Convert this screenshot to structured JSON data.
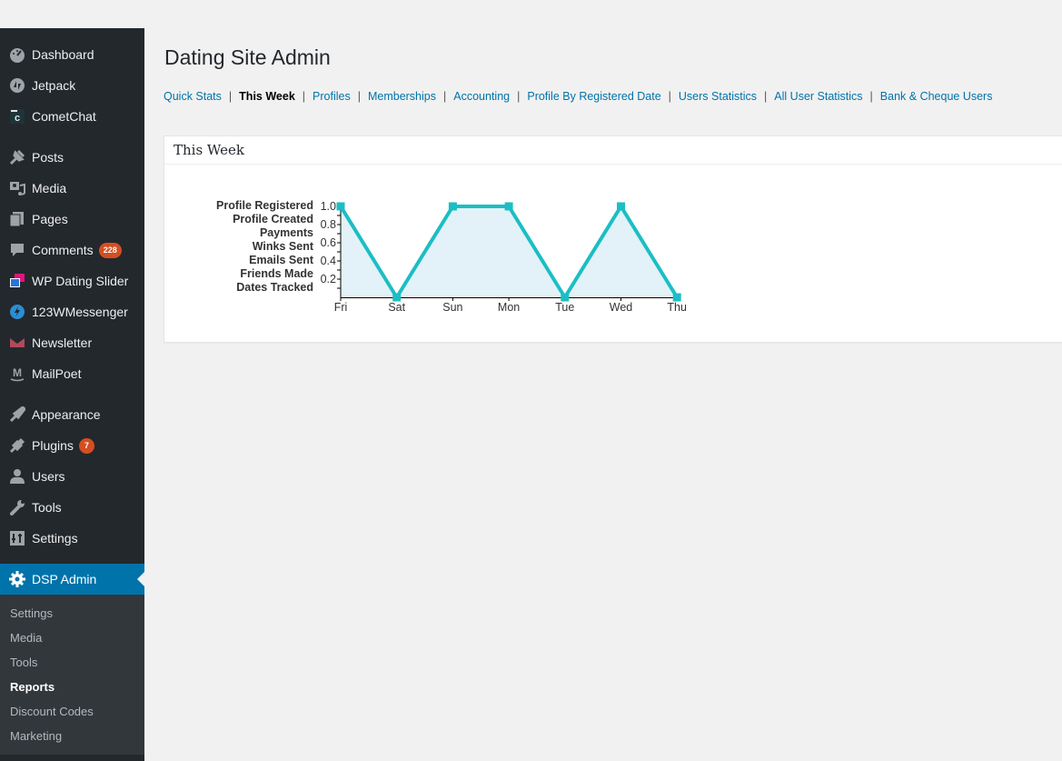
{
  "sidebar": {
    "items": [
      {
        "label": "Dashboard",
        "icon": "dashboard-icon"
      },
      {
        "label": "Jetpack",
        "icon": "jetpack-icon"
      },
      {
        "label": "CometChat",
        "icon": "cometchat-icon"
      },
      {
        "label": "Posts",
        "icon": "pin-icon"
      },
      {
        "label": "Media",
        "icon": "media-icon"
      },
      {
        "label": "Pages",
        "icon": "pages-icon"
      },
      {
        "label": "Comments",
        "icon": "comment-icon",
        "badge": "228"
      },
      {
        "label": "WP Dating Slider",
        "icon": "slider-icon"
      },
      {
        "label": "123WMessenger",
        "icon": "messenger-icon"
      },
      {
        "label": "Newsletter",
        "icon": "envelope-icon"
      },
      {
        "label": "MailPoet",
        "icon": "mailpoet-icon"
      },
      {
        "label": "Appearance",
        "icon": "brush-icon"
      },
      {
        "label": "Plugins",
        "icon": "plug-icon",
        "badge": "7"
      },
      {
        "label": "Users",
        "icon": "user-icon"
      },
      {
        "label": "Tools",
        "icon": "wrench-icon"
      },
      {
        "label": "Settings",
        "icon": "sliders-icon"
      }
    ],
    "active": {
      "label": "DSP Admin",
      "icon": "gear-icon"
    },
    "submenu": [
      {
        "label": "Settings",
        "current": false
      },
      {
        "label": "Media",
        "current": false
      },
      {
        "label": "Tools",
        "current": false
      },
      {
        "label": "Reports",
        "current": true
      },
      {
        "label": "Discount Codes",
        "current": false
      },
      {
        "label": "Marketing",
        "current": false
      }
    ]
  },
  "page": {
    "title": "Dating Site Admin",
    "subnav": [
      {
        "label": "Quick Stats",
        "current": false
      },
      {
        "label": "This Week",
        "current": true
      },
      {
        "label": "Profiles",
        "current": false
      },
      {
        "label": "Memberships",
        "current": false
      },
      {
        "label": "Accounting",
        "current": false
      },
      {
        "label": "Profile By Registered Date",
        "current": false
      },
      {
        "label": "Users Statistics",
        "current": false
      },
      {
        "label": "All User Statistics",
        "current": false
      },
      {
        "label": "Bank & Cheque Users",
        "current": false
      }
    ],
    "separator": "|",
    "panel_title": "This Week"
  },
  "colors": {
    "accent": "#0073aa",
    "line": "#1bbec4",
    "area": "#e2f2f8",
    "badge": "#d54e21"
  },
  "chart_data": {
    "type": "line",
    "title": "This Week",
    "categories": [
      "Fri",
      "Sat",
      "Sun",
      "Mon",
      "Tue",
      "Wed",
      "Thu"
    ],
    "legend": [
      "Profile Registered",
      "Profile Created",
      "Payments",
      "Winks Sent",
      "Emails Sent",
      "Friends Made",
      "Dates Tracked"
    ],
    "legend_position": "left",
    "series": [
      {
        "name": "Profile Registered",
        "values": [
          1,
          0,
          1,
          1,
          0,
          1,
          0
        ]
      }
    ],
    "ylim": [
      0,
      1.0
    ],
    "yticks": [
      0.2,
      0.4,
      0.6,
      0.8,
      1.0
    ],
    "ytick_labels": [
      "0.2",
      "0.4",
      "0.6",
      "0.8",
      "1.0"
    ],
    "xlabel": "",
    "ylabel": "",
    "grid": false,
    "filled_area": true
  }
}
